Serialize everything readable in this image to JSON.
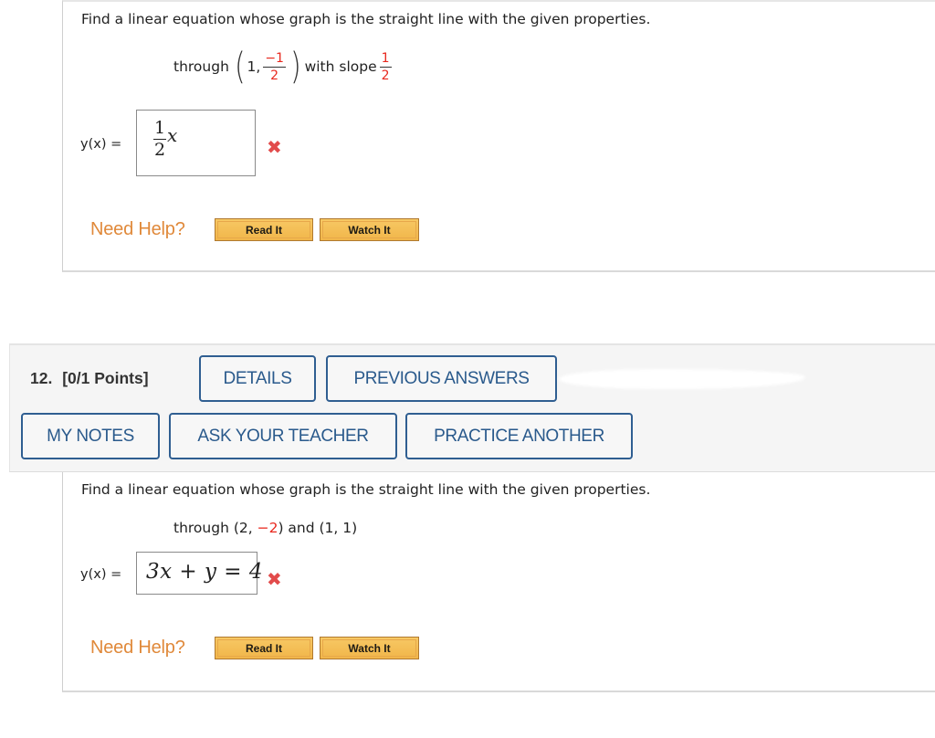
{
  "q11": {
    "prompt": "Find a linear equation whose graph is the straight line with the given properties.",
    "condition": {
      "through_label": "through",
      "point_x": "1,",
      "point_y_num": "−1",
      "point_y_den": "2",
      "with_slope_label": "with slope",
      "slope_num": "1",
      "slope_den": "2"
    },
    "answer_label": "y(x) =",
    "answer": {
      "coef_num": "1",
      "coef_den": "2",
      "variable": "x"
    },
    "result": "incorrect",
    "result_icon": "✖",
    "need_help_label": "Need Help?",
    "read_it_label": "Read It",
    "watch_it_label": "Watch It"
  },
  "q12": {
    "number_label": "12.",
    "points_label": "[0/1 Points]",
    "buttons": {
      "details": "DETAILS",
      "previous_answers": "PREVIOUS ANSWERS",
      "my_notes": "MY NOTES",
      "ask_teacher": "ASK YOUR TEACHER",
      "practice_another": "PRACTICE ANOTHER"
    },
    "prompt": "Find a linear equation whose graph is the straight line with the given properties.",
    "condition": {
      "prefix": "through (2, ",
      "highlight": "−2",
      "suffix": ") and (1, 1)"
    },
    "answer_label": "y(x) =",
    "answer_value": "3x + y = 4",
    "result": "incorrect",
    "result_icon": "✖",
    "need_help_label": "Need Help?",
    "read_it_label": "Read It",
    "watch_it_label": "Watch It"
  },
  "colors": {
    "error_red": "#e8281e",
    "help_orange": "#e0893a",
    "button_blue": "#2a5a8c",
    "header_bg": "#f5f5f5"
  }
}
